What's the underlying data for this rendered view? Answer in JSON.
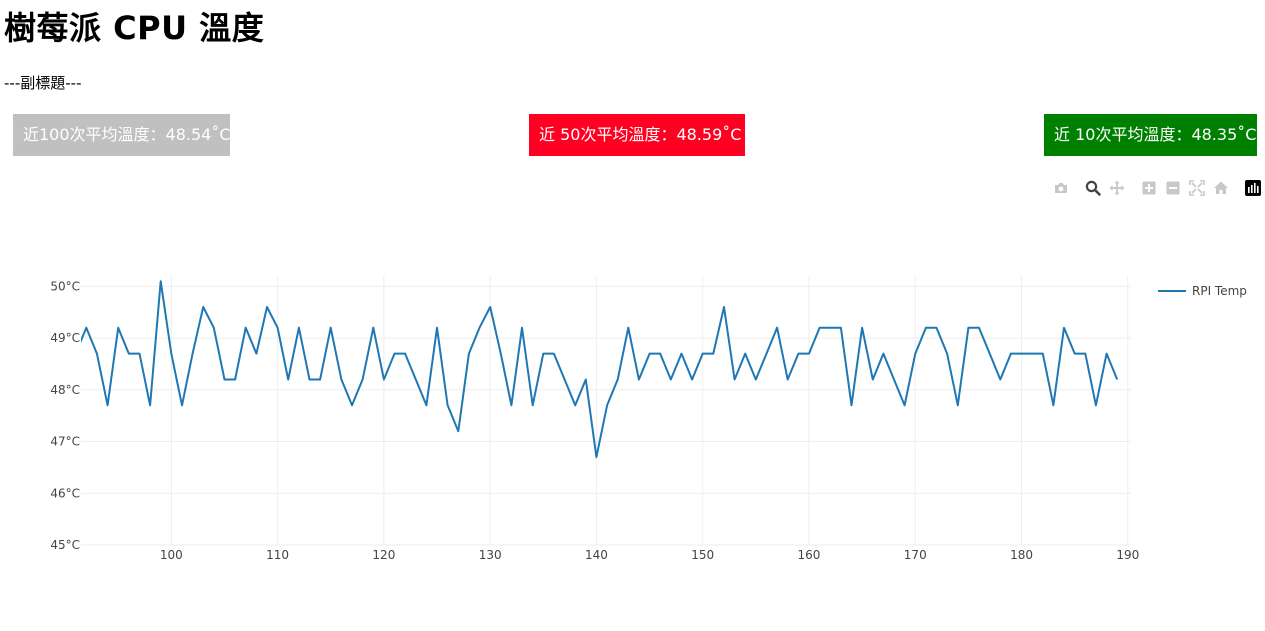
{
  "page": {
    "title": "樹莓派 CPU 溫度",
    "subtitle": "---副標題---"
  },
  "badges": [
    {
      "id": "badge-100",
      "label": "近100次平均溫度：48.54˚C",
      "color": "#c0c0c0"
    },
    {
      "id": "badge-50",
      "label": "近 50次平均溫度：48.59˚C",
      "color": "#ff0022"
    },
    {
      "id": "badge-10",
      "label": "近 10次平均溫度：48.35˚C",
      "color": "#008000"
    }
  ],
  "modebar": {
    "buttons": [
      "camera-icon",
      "zoom-icon",
      "pan-icon",
      "zoom-in-icon",
      "zoom-out-icon",
      "autoscale-icon",
      "reset-axes-icon",
      "plotly-logo-icon"
    ],
    "colors": {
      "inactive": "#c8c8c8",
      "active": "#444444",
      "logo": "#000000"
    }
  },
  "chart_data": {
    "type": "line",
    "title": "",
    "xlabel": "",
    "ylabel": "",
    "xlim": [
      91.5,
      190.3
    ],
    "ylim": [
      45,
      50.2
    ],
    "x_ticks": [
      100,
      110,
      120,
      130,
      140,
      150,
      160,
      170,
      180,
      190
    ],
    "y_ticks": [
      45,
      46,
      47,
      48,
      49,
      50
    ],
    "y_tick_labels": [
      "45°C",
      "46°C",
      "47°C",
      "48°C",
      "49°C",
      "50°C"
    ],
    "grid": true,
    "legend": "top-right",
    "series": [
      {
        "name": "RPI Temp",
        "color": "#1f77b4",
        "x": [
          91,
          92,
          93,
          94,
          95,
          96,
          97,
          98,
          99,
          100,
          101,
          102,
          103,
          104,
          105,
          106,
          107,
          108,
          109,
          110,
          111,
          112,
          113,
          114,
          115,
          116,
          117,
          118,
          119,
          120,
          121,
          122,
          123,
          124,
          125,
          126,
          127,
          128,
          129,
          130,
          131,
          132,
          133,
          134,
          135,
          136,
          137,
          138,
          139,
          140,
          141,
          142,
          143,
          144,
          145,
          146,
          147,
          148,
          149,
          150,
          151,
          152,
          153,
          154,
          155,
          156,
          157,
          158,
          159,
          160,
          161,
          162,
          163,
          164,
          165,
          166,
          167,
          168,
          169,
          170,
          171,
          172,
          173,
          174,
          175,
          176,
          177,
          178,
          179,
          180,
          181,
          182,
          183,
          184,
          185,
          186,
          187,
          188,
          189
        ],
        "values": [
          48.7,
          49.2,
          48.7,
          47.7,
          49.2,
          48.7,
          48.7,
          47.7,
          50.1,
          48.7,
          47.7,
          48.7,
          49.6,
          49.2,
          48.2,
          48.2,
          49.2,
          48.7,
          49.6,
          49.2,
          48.2,
          49.2,
          48.2,
          48.2,
          49.2,
          48.2,
          47.7,
          48.2,
          49.2,
          48.2,
          48.7,
          48.7,
          48.2,
          47.7,
          49.2,
          47.7,
          47.2,
          48.7,
          49.2,
          49.6,
          48.7,
          47.7,
          49.2,
          47.7,
          48.7,
          48.7,
          48.2,
          47.7,
          48.2,
          46.7,
          47.7,
          48.2,
          49.2,
          48.2,
          48.7,
          48.7,
          48.2,
          48.7,
          48.2,
          48.7,
          48.7,
          49.6,
          48.2,
          48.7,
          48.2,
          48.7,
          49.2,
          48.2,
          48.7,
          48.7,
          49.2,
          49.2,
          49.2,
          47.7,
          49.2,
          48.2,
          48.7,
          48.2,
          47.7,
          48.7,
          49.2,
          49.2,
          48.7,
          47.7,
          49.2,
          49.2,
          48.7,
          48.2,
          48.7,
          48.7,
          48.7,
          48.7,
          47.7,
          49.2,
          48.7,
          48.7,
          47.7,
          48.7,
          48.2
        ]
      }
    ]
  }
}
